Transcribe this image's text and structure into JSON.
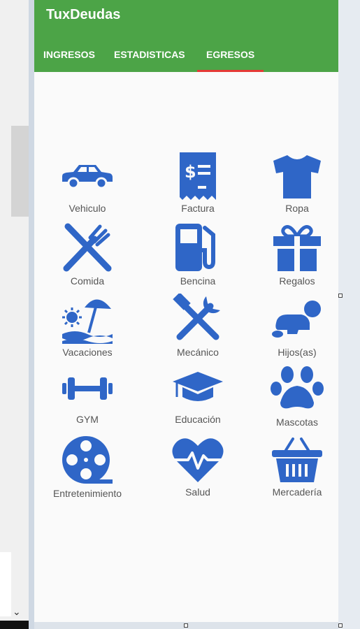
{
  "app_title": "TuxDeudas",
  "tabs": [
    {
      "label": "INGRESOS"
    },
    {
      "label": "ESTADISTICAS"
    },
    {
      "label": "EGRESOS"
    }
  ],
  "active_tab": "EGRESOS",
  "accent_color": "#4ca447",
  "icon_color": "#2f66c7",
  "categories": [
    {
      "label": "Vehiculo",
      "icon": "car-icon"
    },
    {
      "label": "Factura",
      "icon": "receipt-icon"
    },
    {
      "label": "Ropa",
      "icon": "tshirt-icon"
    },
    {
      "label": "Comida",
      "icon": "utensils-icon"
    },
    {
      "label": "Bencina",
      "icon": "gas-pump-icon"
    },
    {
      "label": "Regalos",
      "icon": "gift-icon"
    },
    {
      "label": "Vacaciones",
      "icon": "beach-icon"
    },
    {
      "label": "Mecánico",
      "icon": "tools-icon"
    },
    {
      "label": "Hijos(as)",
      "icon": "baby-icon"
    },
    {
      "label": "GYM",
      "icon": "dumbbell-icon"
    },
    {
      "label": "Educación",
      "icon": "graduation-cap-icon"
    },
    {
      "label": "Mascotas",
      "icon": "paw-icon"
    },
    {
      "label": "Entretenimiento",
      "icon": "film-reel-icon"
    },
    {
      "label": "Salud",
      "icon": "heartbeat-icon"
    },
    {
      "label": "Mercadería",
      "icon": "basket-icon"
    }
  ]
}
